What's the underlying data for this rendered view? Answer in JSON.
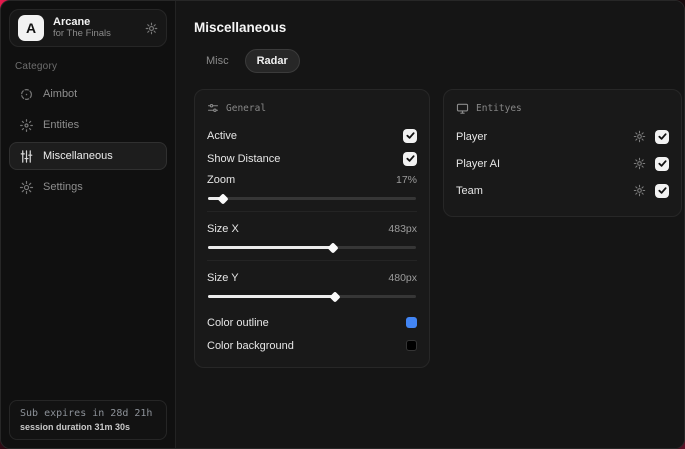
{
  "app": {
    "logo_letter": "A",
    "name": "Arcane",
    "subtitle": "for The Finals"
  },
  "sidebar": {
    "category_label": "Category",
    "items": [
      {
        "label": "Aimbot",
        "icon": "crosshair-icon",
        "active": false
      },
      {
        "label": "Entities",
        "icon": "scan-icon",
        "active": false
      },
      {
        "label": "Miscellaneous",
        "icon": "sliders-icon",
        "active": true
      },
      {
        "label": "Settings",
        "icon": "gear-icon",
        "active": false
      }
    ],
    "footer": {
      "sub_expires": "Sub expires in 28d 21h",
      "session_duration": "session duration 31m 30s"
    }
  },
  "main": {
    "title": "Miscellaneous",
    "tabs": [
      {
        "label": "Misc",
        "active": false
      },
      {
        "label": "Radar",
        "active": true
      }
    ],
    "general_panel": {
      "title": "General",
      "icon": "sliders-horizontal-icon",
      "toggles": [
        {
          "label": "Active",
          "checked": true
        },
        {
          "label": "Show Distance",
          "checked": true
        }
      ],
      "sliders": [
        {
          "label": "Zoom",
          "value": "17%",
          "percent": 7
        },
        {
          "label": "Size X",
          "value": "483px",
          "percent": 60
        },
        {
          "label": "Size Y",
          "value": "480px",
          "percent": 61
        }
      ],
      "color_rows": [
        {
          "label": "Color outline",
          "swatch": "#4285f4"
        },
        {
          "label": "Color background",
          "swatch": "#000000"
        }
      ]
    },
    "entities_panel": {
      "title": "Entityes",
      "icon": "monitor-icon",
      "rows": [
        {
          "label": "Player",
          "checked": true
        },
        {
          "label": "Player AI",
          "checked": true
        },
        {
          "label": "Team",
          "checked": true
        }
      ]
    }
  },
  "colors": {
    "accent_red": "#e81a4e",
    "swatch_blue": "#4285f4",
    "swatch_black": "#000000"
  }
}
